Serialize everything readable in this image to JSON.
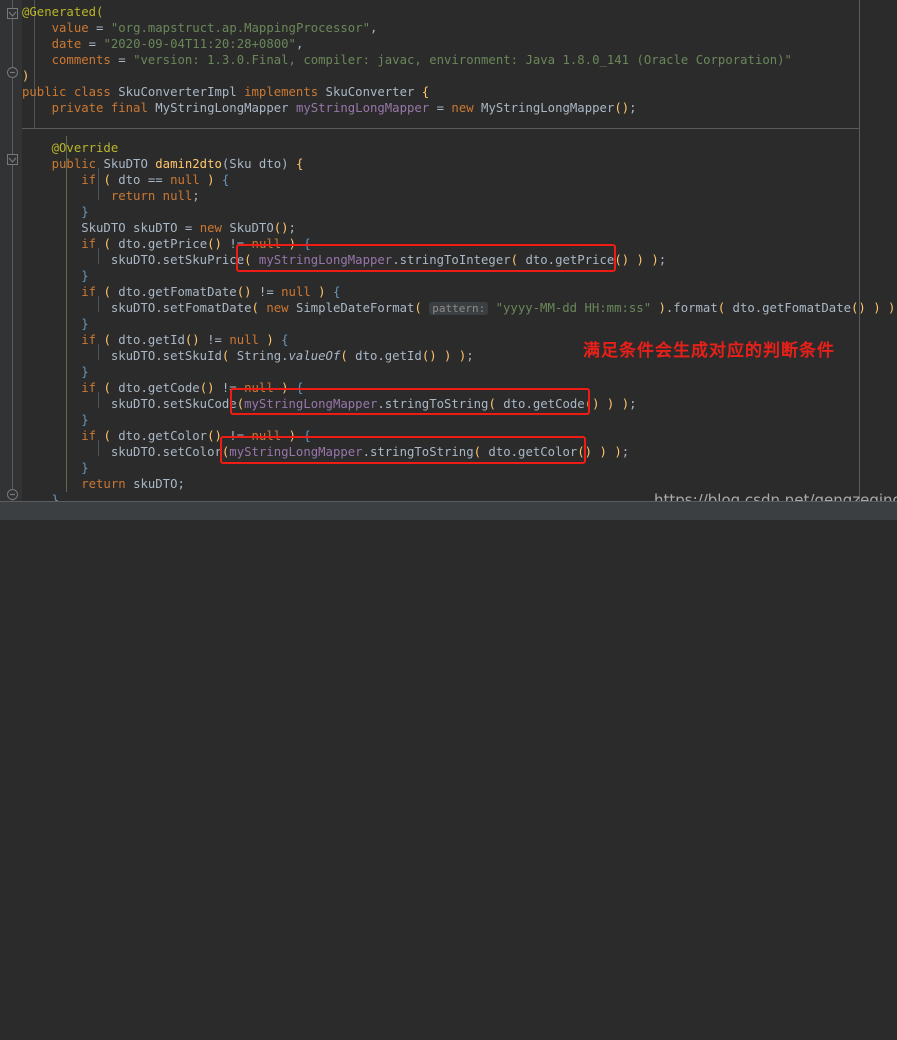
{
  "editor": {
    "theme": "darcula",
    "background": "#2b2b2b",
    "gutter_background": "#313335",
    "default_text_color": "#a9b7c6",
    "keyword_color": "#cc7832",
    "string_color": "#6a8759",
    "annotation_color": "#bbb529",
    "field_color": "#9876aa",
    "method_color": "#ffc66d",
    "number_color": "#6897bb",
    "highlight_box_color": "#ef1c16",
    "note_color": "#e8201a"
  },
  "code_lines": [
    {
      "indent": 0,
      "text": "@Generated("
    },
    {
      "indent": 1,
      "text": "value = \"org.mapstruct.ap.MappingProcessor\","
    },
    {
      "indent": 1,
      "text": "date = \"2020-09-04T11:20:28+0800\","
    },
    {
      "indent": 1,
      "text": "comments = \"version: 1.3.0.Final, compiler: javac, environment: Java 1.8.0_141 (Oracle Corporation)\""
    },
    {
      "indent": 0,
      "text": ")"
    },
    {
      "indent": 0,
      "text": "public class SkuConverterImpl implements SkuConverter {"
    },
    {
      "indent": 1,
      "text": "private final MyStringLongMapper myStringLongMapper = new MyStringLongMapper();"
    },
    {
      "indent": 0,
      "text": ""
    },
    {
      "indent": 1,
      "text": "@Override"
    },
    {
      "indent": 1,
      "text": "public SkuDTO damin2dto(Sku dto) {"
    },
    {
      "indent": 2,
      "text": "if ( dto == null ) {"
    },
    {
      "indent": 3,
      "text": "return null;"
    },
    {
      "indent": 2,
      "text": "}"
    },
    {
      "indent": 2,
      "text": "SkuDTO skuDTO = new SkuDTO();"
    },
    {
      "indent": 2,
      "text": "if ( dto.getPrice() != null ) {"
    },
    {
      "indent": 3,
      "text": "skuDTO.setSkuPrice( myStringLongMapper.stringToInteger( dto.getPrice() ) );"
    },
    {
      "indent": 2,
      "text": "}"
    },
    {
      "indent": 2,
      "text": "if ( dto.getFomatDate() != null ) {"
    },
    {
      "indent": 3,
      "text": "skuDTO.setFomatDate( new SimpleDateFormat( pattern: \"yyyy-MM-dd HH:mm:ss\" ).format( dto.getFomatDate() ) );"
    },
    {
      "indent": 2,
      "text": "}"
    },
    {
      "indent": 2,
      "text": "if ( dto.getId() != null ) {"
    },
    {
      "indent": 3,
      "text": "skuDTO.setSkuId( String.valueOf( dto.getId() ) );"
    },
    {
      "indent": 2,
      "text": "}"
    },
    {
      "indent": 2,
      "text": "if ( dto.getCode() != null ) {"
    },
    {
      "indent": 3,
      "text": "skuDTO.setSkuCode( myStringLongMapper.stringToString( dto.getCode() ) );"
    },
    {
      "indent": 2,
      "text": "}"
    },
    {
      "indent": 2,
      "text": "if ( dto.getColor() != null ) {"
    },
    {
      "indent": 3,
      "text": "skuDTO.setColor( myStringLongMapper.stringToString( dto.getColor() ) );"
    },
    {
      "indent": 2,
      "text": "}"
    },
    {
      "indent": 2,
      "text": "return skuDTO;"
    },
    {
      "indent": 1,
      "text": "}"
    }
  ],
  "parameter_hints": [
    {
      "label": "pattern:"
    }
  ],
  "annotations": {
    "note_text": "满足条件会生成对应的判断条件",
    "highlight_boxes": [
      {
        "label": "myStringLongMapper.stringToInteger( dto.getPrice() )"
      },
      {
        "label": "myStringLongMapper.stringToString( dto.getCode() )"
      },
      {
        "label": "myStringLongMapper.stringToString( dto.getColor() )"
      }
    ]
  },
  "watermark": {
    "url": "https://blog.csdn.net/gengzeqing"
  },
  "gutter": {
    "fold_markers": [
      {
        "type": "fold-collapse-top",
        "name": "fold-marker-generated-start"
      },
      {
        "type": "fold-collapse-end",
        "name": "fold-marker-generated-end"
      },
      {
        "type": "fold-collapse-top",
        "name": "fold-marker-method-start"
      },
      {
        "type": "fold-collapse-end",
        "name": "fold-marker-method-end"
      }
    ]
  }
}
